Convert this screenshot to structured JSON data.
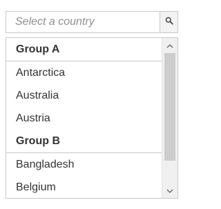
{
  "search": {
    "placeholder": "Select a country",
    "value": "",
    "button_icon": "search-icon"
  },
  "list": {
    "groups": [
      {
        "label": "Group A",
        "items": [
          "Antarctica",
          "Australia",
          "Austria"
        ]
      },
      {
        "label": "Group B",
        "items": [
          "Bangladesh",
          "Belgium"
        ]
      }
    ]
  },
  "scrollbar": {
    "up_icon": "chevron-up-icon",
    "down_icon": "chevron-down-icon"
  },
  "colors": {
    "border": "#c8c8c8",
    "text": "#333333",
    "placeholder": "#8f8f8f",
    "scroll_track": "#f0f0f0",
    "scroll_thumb": "#cdcdcd"
  }
}
